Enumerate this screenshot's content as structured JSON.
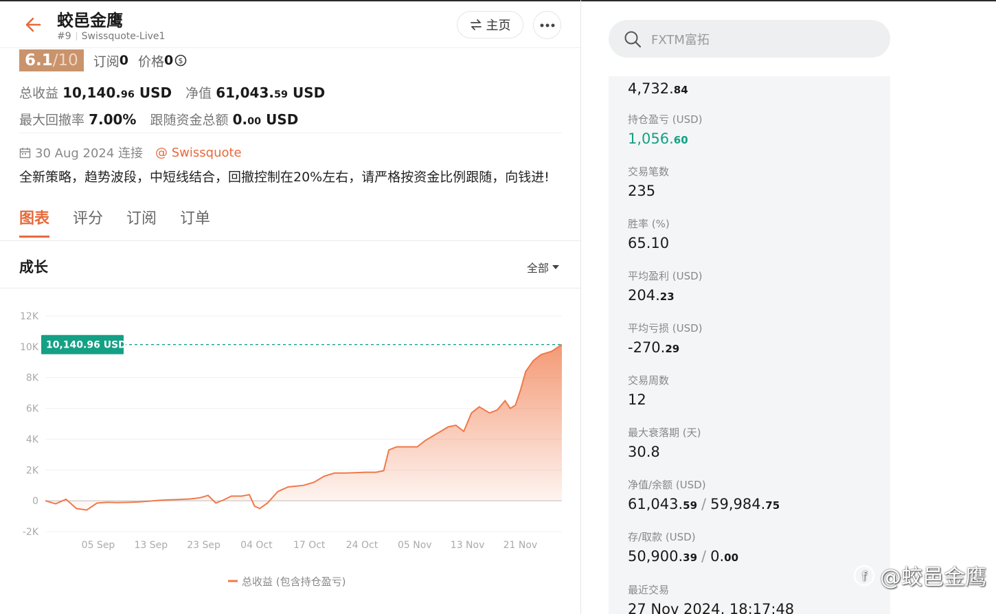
{
  "header": {
    "title": "蛟邑金鹰",
    "rank": "#9",
    "account": "Swissquote-Live1",
    "home_label": "主页"
  },
  "score": {
    "value": "6.1",
    "denominator": "/10",
    "subscribe_label": "订阅",
    "subscribe_count": "0",
    "price_label": "价格",
    "price_value": "0"
  },
  "summary": {
    "total_profit_label": "总收益",
    "total_profit_int": "10,140.",
    "total_profit_dec": "96",
    "total_profit_unit": " USD",
    "equity_label": "净值",
    "equity_int": "61,043.",
    "equity_dec": "59",
    "equity_unit": " USD",
    "max_drawdown_label": "最大回撤率",
    "max_drawdown_value": "7.00%",
    "follow_funds_label": "跟随资金总额",
    "follow_funds_int": "0.",
    "follow_funds_dec": "00",
    "follow_funds_unit": " USD"
  },
  "connect": {
    "date": "30 Aug 2024 连接",
    "broker": "@ Swissquote"
  },
  "description": "全新策略，趋势波段，中短线结合，回撤控制在20%左右，请严格按资金比例跟随，向钱进!",
  "tabs": [
    "图表",
    "评分",
    "订阅",
    "订单"
  ],
  "growth": {
    "title": "成长",
    "range": "全部"
  },
  "chart_data": {
    "type": "area",
    "ylim": [
      -2000,
      12000
    ],
    "yticks": [
      -2000,
      0,
      2000,
      4000,
      6000,
      8000,
      10000,
      12000
    ],
    "ytick_labels": [
      "-2K",
      "0",
      "2K",
      "4K",
      "6K",
      "8K",
      "10K",
      "12K"
    ],
    "xtick_labels": [
      "05 Sep",
      "13 Sep",
      "23 Sep",
      "04 Oct",
      "17 Oct",
      "24 Oct",
      "05 Nov",
      "13 Nov",
      "21 Nov"
    ],
    "current_label": "10,140.96 USD",
    "current_value": 10140.96,
    "legend": "总收益 (包含持仓盈亏)",
    "color": "#f07848",
    "series": [
      {
        "points": [
          [
            0,
            0
          ],
          [
            0.02,
            -200
          ],
          [
            0.04,
            100
          ],
          [
            0.06,
            -500
          ],
          [
            0.08,
            -600
          ],
          [
            0.1,
            -150
          ],
          [
            0.12,
            -100
          ],
          [
            0.14,
            -120
          ],
          [
            0.16,
            -100
          ],
          [
            0.18,
            -80
          ],
          [
            0.2,
            -30
          ],
          [
            0.22,
            30
          ],
          [
            0.24,
            60
          ],
          [
            0.26,
            80
          ],
          [
            0.28,
            120
          ],
          [
            0.3,
            200
          ],
          [
            0.315,
            350
          ],
          [
            0.33,
            -150
          ],
          [
            0.345,
            50
          ],
          [
            0.36,
            300
          ],
          [
            0.38,
            300
          ],
          [
            0.395,
            400
          ],
          [
            0.405,
            -350
          ],
          [
            0.415,
            -500
          ],
          [
            0.43,
            -150
          ],
          [
            0.45,
            600
          ],
          [
            0.47,
            900
          ],
          [
            0.5,
            1000
          ],
          [
            0.52,
            1200
          ],
          [
            0.54,
            1600
          ],
          [
            0.56,
            1800
          ],
          [
            0.58,
            1800
          ],
          [
            0.62,
            1850
          ],
          [
            0.64,
            1850
          ],
          [
            0.655,
            1950
          ],
          [
            0.665,
            3300
          ],
          [
            0.68,
            3500
          ],
          [
            0.72,
            3500
          ],
          [
            0.735,
            3900
          ],
          [
            0.75,
            4200
          ],
          [
            0.76,
            4400
          ],
          [
            0.78,
            4800
          ],
          [
            0.795,
            4900
          ],
          [
            0.81,
            4500
          ],
          [
            0.825,
            5700
          ],
          [
            0.84,
            6100
          ],
          [
            0.86,
            5700
          ],
          [
            0.875,
            5900
          ],
          [
            0.89,
            6500
          ],
          [
            0.9,
            6000
          ],
          [
            0.91,
            6200
          ],
          [
            0.92,
            7200
          ],
          [
            0.93,
            8400
          ],
          [
            0.945,
            9100
          ],
          [
            0.96,
            9500
          ],
          [
            0.98,
            9700
          ],
          [
            1.0,
            10140.96
          ]
        ]
      }
    ]
  },
  "search": {
    "placeholder": "FXTM富拓"
  },
  "stats": [
    {
      "label": "",
      "int": "4,732.",
      "dec": "84",
      "color": "default"
    },
    {
      "label": "持仓盈亏 (USD)",
      "int": "1,056.",
      "dec": "60",
      "color": "green"
    },
    {
      "label": "交易笔数",
      "int": "235",
      "dec": "",
      "color": "default"
    },
    {
      "label": "胜率 (%)",
      "int": "65.10",
      "dec": "",
      "color": "default"
    },
    {
      "label": "平均盈利 (USD)",
      "int": "204.",
      "dec": "23",
      "color": "default"
    },
    {
      "label": "平均亏损 (USD)",
      "int": "-270.",
      "dec": "29",
      "color": "default"
    },
    {
      "label": "交易周数",
      "int": "12",
      "dec": "",
      "color": "default"
    },
    {
      "label": "最大衰落期 (天)",
      "int": "30.8",
      "dec": "",
      "color": "default"
    }
  ],
  "equity_balance": {
    "label": "净值/余额 (USD)",
    "a_int": "61,043.",
    "a_dec": "59",
    "b_int": "59,984.",
    "b_dec": "75"
  },
  "deposit_withdraw": {
    "label": "存/取款 (USD)",
    "a_int": "50,900.",
    "a_dec": "39",
    "b_int": "0.",
    "b_dec": "00"
  },
  "last_trade": {
    "label": "最近交易",
    "value": "27 Nov 2024, 18:17:48"
  },
  "watermark": "@蛟邑金鹰"
}
